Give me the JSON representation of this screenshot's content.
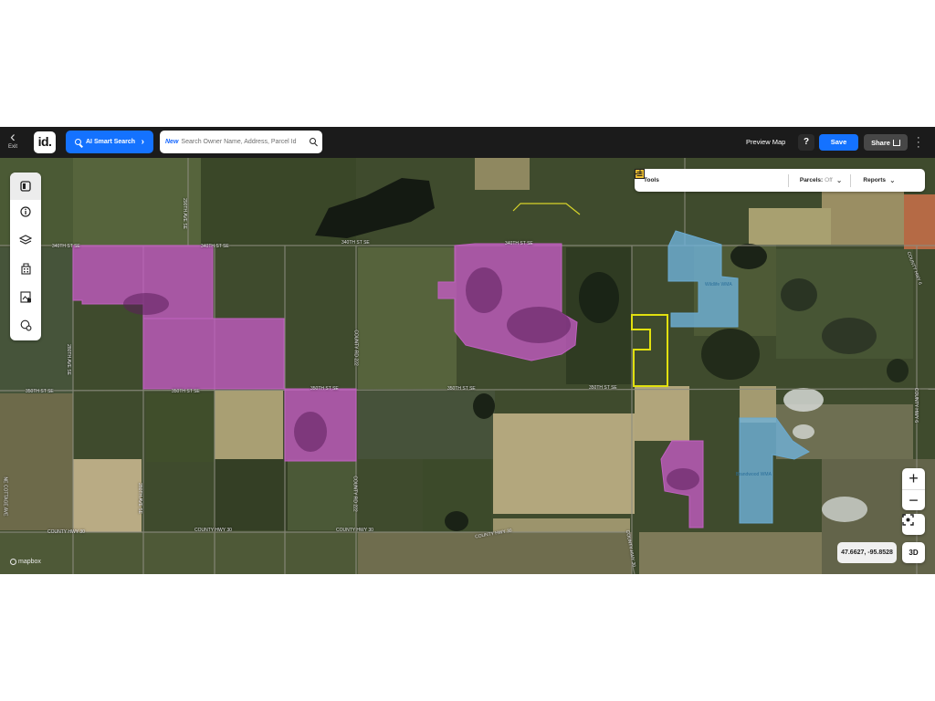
{
  "header": {
    "exit_label": "Exit",
    "logo_text": "id.",
    "ai_search_label": "AI Smart Search",
    "search_new_tag": "New",
    "search_placeholder": "Search Owner Name, Address, Parcel Id",
    "preview_map_label": "Preview Map",
    "help_label": "?",
    "save_label": "Save",
    "share_label": "Share"
  },
  "sidebar": {
    "items": [
      {
        "icon": "panel-icon"
      },
      {
        "icon": "info-icon"
      },
      {
        "icon": "layers-icon"
      },
      {
        "icon": "buildings-icon"
      },
      {
        "icon": "map-image-icon"
      },
      {
        "icon": "pin-settings-icon"
      }
    ]
  },
  "toolbar": {
    "tools_label": "Tools",
    "parcels_label": "Parcels:",
    "parcels_state": "Off",
    "reports_label": "Reports"
  },
  "roads": {
    "r1": "340TH ST SE",
    "r2": "340TH ST SE",
    "r3": "340TH ST SE",
    "r4": "340TH ST SE",
    "r5": "350TH ST SE",
    "r6": "350TH ST SE",
    "r7": "350TH ST SE",
    "r8": "350TH ST SE",
    "r9": "350TH ST SE",
    "r10": "COUNTY HWY 30",
    "r11": "COUNTY HWY 30",
    "r12": "COUNTY HWY 30",
    "r13": "COUNTY HWY 30",
    "v1": "290TH AVE SE",
    "v2": "280TH AVE SE",
    "v3": "280TH AVE SE",
    "v4": "COUNTY RD 222",
    "v5": "COUNTY RD 222",
    "v6": "COUNTY HWY 30",
    "v7": "NE COTTAGE AVE",
    "v8": "COUNTY HWY 6",
    "v9": "COUNTY HWY 6",
    "w1": "Wildlife WMA",
    "w2": "Brandwood WMA"
  },
  "map_controls": {
    "zoom_in": "+",
    "zoom_out": "−",
    "coordinates": "47.6627, -95.8528",
    "btn_3d": "3D",
    "attribution": "mapbox"
  },
  "colors": {
    "topbar": "#1b1b1b",
    "primary_blue": "#1472ff",
    "parcel_pink": "#c45bc4",
    "parcel_blue": "#6fb1d9",
    "parcel_outline_yellow": "#e1e00f"
  }
}
